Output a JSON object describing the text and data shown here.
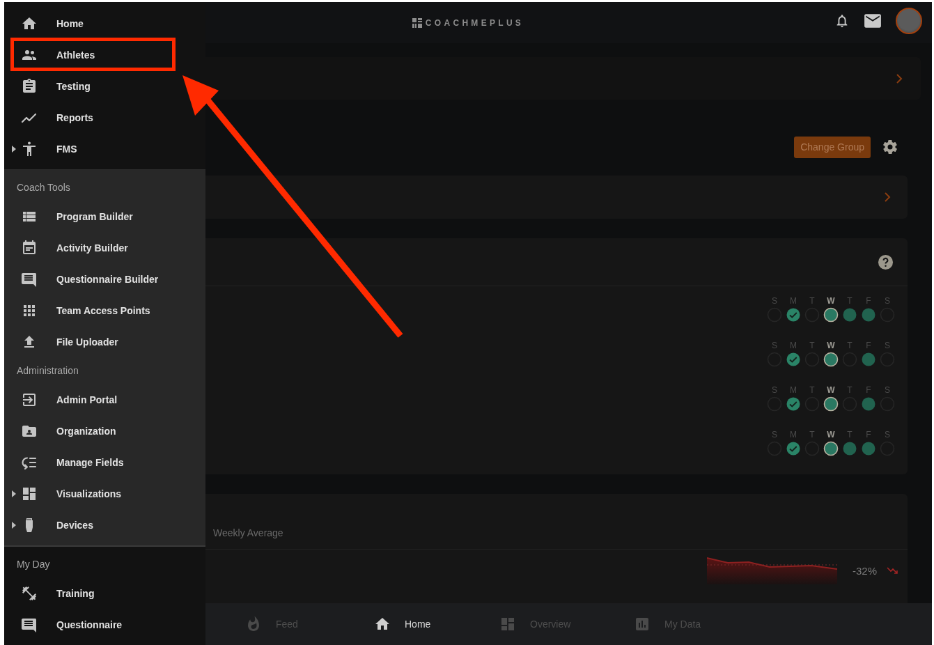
{
  "header": {
    "logo": "COACHMEPLUS"
  },
  "drawer": {
    "items": [
      {
        "label": "Home",
        "expandable": false,
        "annotated": false
      },
      {
        "label": "Athletes",
        "expandable": false,
        "annotated": true
      },
      {
        "label": "Testing",
        "expandable": false,
        "annotated": false
      },
      {
        "label": "Reports",
        "expandable": false,
        "annotated": false
      },
      {
        "label": "FMS",
        "expandable": true,
        "annotated": false
      }
    ],
    "tools_panel": [
      {
        "title": "Coach Tools",
        "items": [
          {
            "label": "Program Builder",
            "expandable": false,
            "annotated": false
          },
          {
            "label": "Activity Builder",
            "expandable": false,
            "annotated": false
          },
          {
            "label": "Questionnaire Builder",
            "expandable": false,
            "annotated": false
          },
          {
            "label": "Team Access Points",
            "expandable": false,
            "annotated": false
          },
          {
            "label": "File Uploader",
            "expandable": false,
            "annotated": false
          }
        ]
      },
      {
        "title": "Administration",
        "items": [
          {
            "label": "Admin Portal",
            "expandable": false,
            "annotated": false
          },
          {
            "label": "Organization",
            "expandable": false,
            "annotated": false
          },
          {
            "label": "Manage Fields",
            "expandable": false,
            "annotated": false
          },
          {
            "label": "Visualizations",
            "expandable": true,
            "annotated": false
          },
          {
            "label": "Devices",
            "expandable": true,
            "annotated": false
          }
        ]
      }
    ],
    "my_day": {
      "title": "My Day",
      "items": [
        {
          "label": "Training",
          "expandable": false,
          "annotated": false
        },
        {
          "label": "Questionnaire",
          "expandable": false,
          "annotated": false
        }
      ]
    }
  },
  "main": {
    "change_group_button": "Change Group",
    "habits": [
      {
        "days": [
          {
            "letter": "S",
            "completed": false,
            "scheduled": false,
            "today": false
          },
          {
            "letter": "M",
            "completed": true,
            "scheduled": false,
            "today": false
          },
          {
            "letter": "T",
            "completed": false,
            "scheduled": false,
            "today": false
          },
          {
            "letter": "W",
            "completed": false,
            "scheduled": true,
            "today": true
          },
          {
            "letter": "T",
            "completed": false,
            "scheduled": true,
            "today": false
          },
          {
            "letter": "F",
            "completed": false,
            "scheduled": true,
            "today": false
          },
          {
            "letter": "S",
            "completed": false,
            "scheduled": false,
            "today": false
          }
        ]
      },
      {
        "days": [
          {
            "letter": "S",
            "completed": false,
            "scheduled": false,
            "today": false
          },
          {
            "letter": "M",
            "completed": true,
            "scheduled": false,
            "today": false
          },
          {
            "letter": "T",
            "completed": false,
            "scheduled": false,
            "today": false
          },
          {
            "letter": "W",
            "completed": false,
            "scheduled": true,
            "today": true
          },
          {
            "letter": "T",
            "completed": false,
            "scheduled": false,
            "today": false
          },
          {
            "letter": "F",
            "completed": false,
            "scheduled": true,
            "today": false
          },
          {
            "letter": "S",
            "completed": false,
            "scheduled": false,
            "today": false
          }
        ]
      },
      {
        "days": [
          {
            "letter": "S",
            "completed": false,
            "scheduled": false,
            "today": false
          },
          {
            "letter": "M",
            "completed": true,
            "scheduled": false,
            "today": false
          },
          {
            "letter": "T",
            "completed": false,
            "scheduled": false,
            "today": false
          },
          {
            "letter": "W",
            "completed": false,
            "scheduled": true,
            "today": true
          },
          {
            "letter": "T",
            "completed": false,
            "scheduled": false,
            "today": false
          },
          {
            "letter": "F",
            "completed": false,
            "scheduled": true,
            "today": false
          },
          {
            "letter": "S",
            "completed": false,
            "scheduled": false,
            "today": false
          }
        ]
      },
      {
        "days": [
          {
            "letter": "S",
            "completed": false,
            "scheduled": false,
            "today": false
          },
          {
            "letter": "M",
            "completed": true,
            "scheduled": false,
            "today": false
          },
          {
            "letter": "T",
            "completed": false,
            "scheduled": false,
            "today": false
          },
          {
            "letter": "W",
            "completed": false,
            "scheduled": true,
            "today": true
          },
          {
            "letter": "T",
            "completed": false,
            "scheduled": true,
            "today": false
          },
          {
            "letter": "F",
            "completed": false,
            "scheduled": true,
            "today": false
          },
          {
            "letter": "S",
            "completed": false,
            "scheduled": false,
            "today": false
          }
        ]
      }
    ],
    "weekly_card": {
      "subtitle": "Weekly Average",
      "change": "-32%"
    }
  },
  "bottom_nav": [
    {
      "label": "Feed",
      "selected": false
    },
    {
      "label": "Home",
      "selected": true
    },
    {
      "label": "Overview",
      "selected": false
    },
    {
      "label": "My Data",
      "selected": false
    }
  ]
}
